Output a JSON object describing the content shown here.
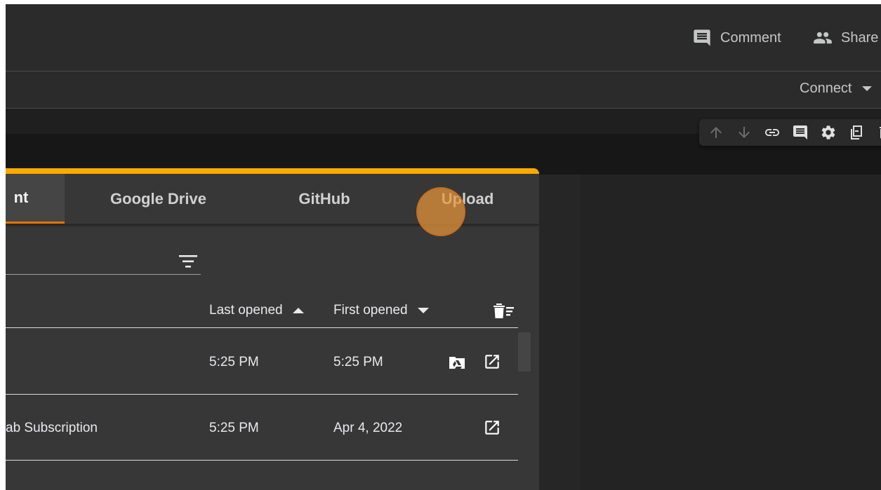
{
  "header": {
    "comment_label": "Comment",
    "share_label": "Share"
  },
  "menubar": {
    "connect_label": "Connect"
  },
  "dialog": {
    "tabs": [
      {
        "label": "nt",
        "active": true
      },
      {
        "label": "Google Drive",
        "active": false
      },
      {
        "label": "GitHub",
        "active": false
      },
      {
        "label": "Upload",
        "active": false
      }
    ],
    "filter": {
      "value": "",
      "placeholder": ""
    },
    "columns": {
      "last_opened": "Last opened",
      "first_opened": "First opened"
    },
    "rows": [
      {
        "title": "",
        "last_opened": "5:25 PM",
        "first_opened": "5:25 PM",
        "has_drive_icon": true
      },
      {
        "title": "ab Subscription",
        "last_opened": "5:25 PM",
        "first_opened": "Apr 4, 2022",
        "has_drive_icon": false
      }
    ]
  },
  "colors": {
    "accent": "#f9ab00",
    "active_tab_underline": "#e37400",
    "dialog_bg": "#373737",
    "topbar_bg": "#2b2b2b"
  },
  "icons": [
    "comment-icon",
    "people-icon",
    "arrow-up-icon",
    "arrow-down-icon",
    "link-icon",
    "comment-icon",
    "gear-icon",
    "mirror-cell-icon",
    "delete-icon",
    "filter-icon",
    "delete-sort-icon",
    "drive-folder-icon",
    "open-in-new-icon"
  ]
}
